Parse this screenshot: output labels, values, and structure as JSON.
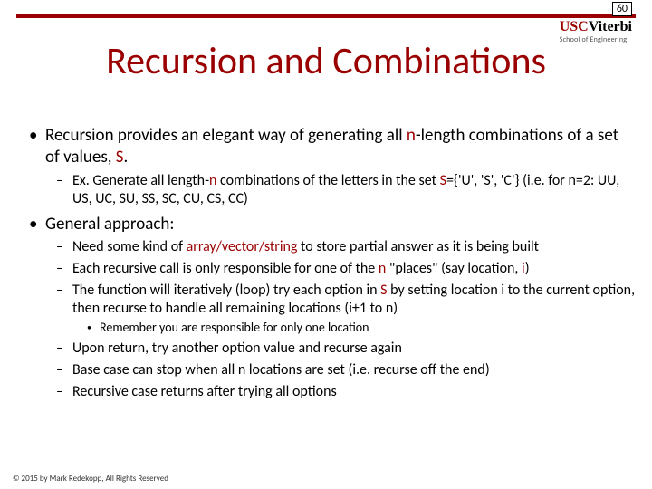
{
  "page_number": "60",
  "logo": {
    "usc": "USC",
    "viterbi": "Viterbi",
    "sub": "School of Engineering"
  },
  "title": "Recursion and Combinations",
  "bullets": {
    "b1": {
      "runs": [
        {
          "t": "Recursion provides an elegant way of generating all "
        },
        {
          "t": "n",
          "color": "#9a0000"
        },
        {
          "t": "-length combinations of a set of values, "
        },
        {
          "t": "S",
          "color": "#9a0000"
        },
        {
          "t": "."
        }
      ],
      "sub": {
        "s1": {
          "runs": [
            {
              "t": "Ex.  Generate all length-"
            },
            {
              "t": "n",
              "color": "#9a0000"
            },
            {
              "t": " combinations of the letters in the set "
            },
            {
              "t": "S",
              "color": "#9a0000"
            },
            {
              "t": "={'U', 'S', 'C'} (i.e. for n=2: UU, US, UC, SU, SS, SC, CU, CS, CC)"
            }
          ]
        }
      }
    },
    "b2": {
      "runs": [
        {
          "t": "General approach:"
        }
      ],
      "sub": {
        "s1": {
          "runs": [
            {
              "t": "Need some kind of "
            },
            {
              "t": "array/vector/string",
              "color": "#9a0000"
            },
            {
              "t": " to store partial answer as it is being built"
            }
          ]
        },
        "s2": {
          "runs": [
            {
              "t": "Each recursive call is only responsible for one of the "
            },
            {
              "t": "n",
              "color": "#9a0000"
            },
            {
              "t": " \"places\" (say location, "
            },
            {
              "t": "i",
              "color": "#9a0000"
            },
            {
              "t": ")"
            }
          ]
        },
        "s3": {
          "runs": [
            {
              "t": "The function will iteratively (loop) try each option in "
            },
            {
              "t": "S",
              "color": "#9a0000"
            },
            {
              "t": " by setting  location i to the current option, then recurse to handle all remaining locations (i+1 to n)"
            }
          ],
          "sub": {
            "t1": {
              "runs": [
                {
                  "t": "Remember you are responsible for only one location"
                }
              ]
            }
          }
        },
        "s4": {
          "runs": [
            {
              "t": "Upon return, try another option value and recurse again"
            }
          ]
        },
        "s5": {
          "runs": [
            {
              "t": "Base case can stop when all n locations are set (i.e. recurse off the end)"
            }
          ]
        },
        "s6": {
          "runs": [
            {
              "t": "Recursive case returns after trying all options"
            }
          ]
        }
      }
    }
  },
  "footer": "© 2015 by Mark Redekopp, All Rights Reserved"
}
